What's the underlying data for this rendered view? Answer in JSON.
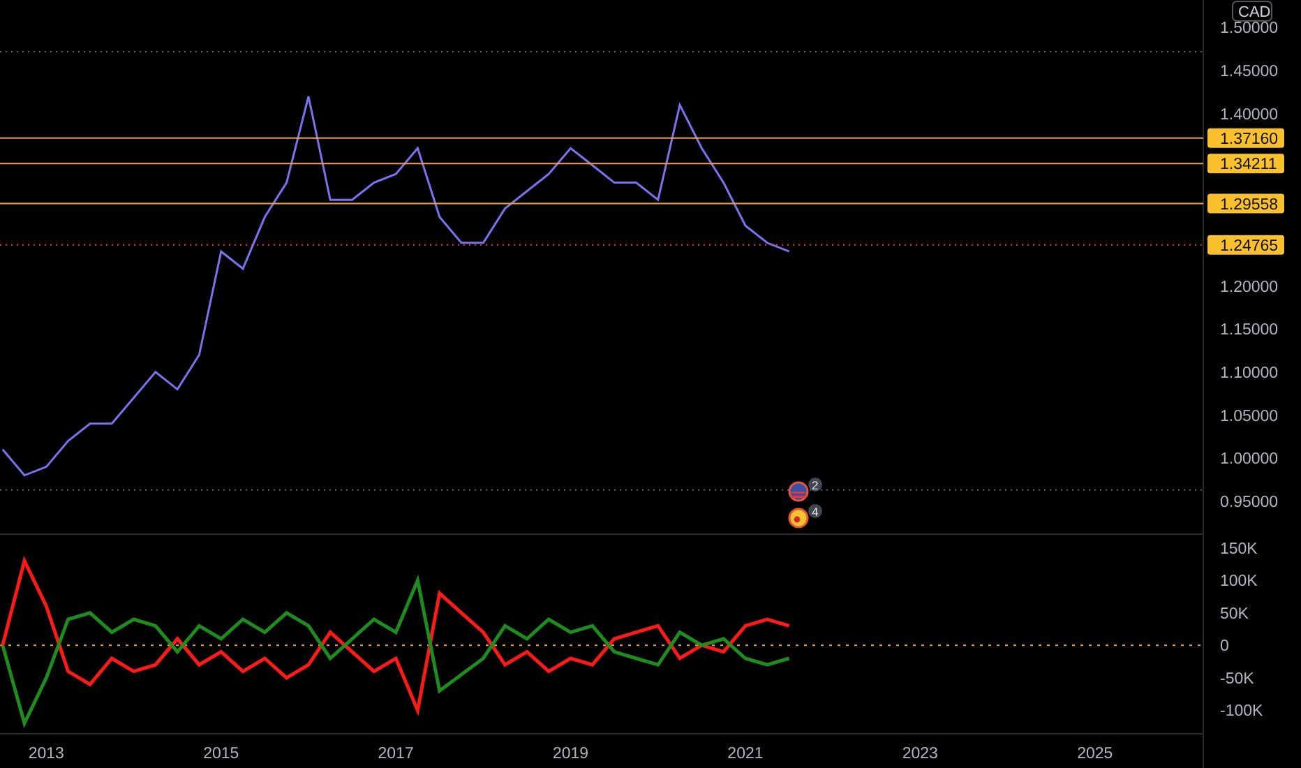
{
  "price_axis": {
    "currency": "CAD"
  },
  "main_chart": {
    "chart_data": {
      "type": "line",
      "series": [
        {
          "color": "#7b72ee",
          "values": [
            1.01,
            0.98,
            0.99,
            1.02,
            1.04,
            1.04,
            1.07,
            1.1,
            1.08,
            1.12,
            1.24,
            1.22,
            1.28,
            1.32,
            1.42,
            1.3,
            1.3,
            1.32,
            1.33,
            1.36,
            1.28,
            1.25,
            1.25,
            1.29,
            1.31,
            1.33,
            1.36,
            1.34,
            1.32,
            1.32,
            1.3,
            1.41,
            1.36,
            1.32,
            1.27,
            1.25,
            1.24
          ]
        }
      ],
      "ylim": [
        0.911,
        1.532
      ],
      "yticks": [
        {
          "value": 0.95,
          "label": "0.95000"
        },
        {
          "value": 1.0,
          "label": "1.00000"
        },
        {
          "value": 1.05,
          "label": "1.05000"
        },
        {
          "value": 1.1,
          "label": "1.10000"
        },
        {
          "value": 1.15,
          "label": "1.15000"
        },
        {
          "value": 1.2,
          "label": "1.20000"
        },
        {
          "value": 1.4,
          "label": "1.40000"
        },
        {
          "value": 1.45,
          "label": "1.45000"
        },
        {
          "value": 1.5,
          "label": "1.50000"
        }
      ],
      "ref_lines": [
        {
          "axis": "y",
          "value": 1.472,
          "color": "#666666"
        },
        {
          "axis": "y",
          "value": 1.3716,
          "label": "1.37160",
          "color": "#f5a623"
        },
        {
          "axis": "y",
          "value": 1.34211,
          "label": "1.34211",
          "color": "#f5a623"
        },
        {
          "axis": "y",
          "value": 1.29558,
          "label": "1.29558",
          "color": "#f5a623"
        },
        {
          "axis": "y",
          "value": 1.24765,
          "label": "1.24765",
          "color": "#e0454b"
        },
        {
          "axis": "y",
          "value": 0.963,
          "color": "#666666"
        }
      ]
    },
    "events": [
      {
        "kind": "striped",
        "count": "2"
      },
      {
        "kind": "emblem",
        "count": "4"
      }
    ]
  },
  "oscillator": {
    "chart_data": {
      "type": "line",
      "x": [
        2012.5,
        2012.75,
        2013,
        2013.25,
        2013.5,
        2013.75,
        2014,
        2014.25,
        2014.5,
        2014.75,
        2015,
        2015.25,
        2015.5,
        2015.75,
        2016,
        2016.25,
        2016.5,
        2016.75,
        2017,
        2017.25,
        2017.5,
        2017.75,
        2018,
        2018.25,
        2018.5,
        2018.75,
        2019,
        2019.25,
        2019.5,
        2019.75,
        2020,
        2020.25,
        2020.5,
        2020.75,
        2021,
        2021.25,
        2021.5
      ],
      "series": [
        {
          "color": "#ff1a1a",
          "values": [
            0,
            130,
            60,
            -40,
            -60,
            -20,
            -40,
            -30,
            10,
            -30,
            -10,
            -40,
            -20,
            -50,
            -30,
            20,
            -10,
            -40,
            -20,
            -100,
            80,
            50,
            20,
            -30,
            -10,
            -40,
            -20,
            -30,
            10,
            20,
            30,
            -20,
            0,
            -10,
            30,
            40,
            30
          ]
        },
        {
          "color": "#1e8c1e",
          "values": [
            0,
            -120,
            -50,
            40,
            50,
            20,
            40,
            30,
            -10,
            30,
            10,
            40,
            20,
            50,
            30,
            -20,
            10,
            40,
            20,
            100,
            -70,
            -45,
            -20,
            30,
            10,
            40,
            20,
            30,
            -10,
            -20,
            -30,
            20,
            0,
            10,
            -20,
            -30,
            -20
          ]
        }
      ],
      "xlim": [
        2012.47,
        2026.24
      ],
      "ylim": [
        -135,
        170
      ],
      "yticks": [
        {
          "value": 150,
          "label": "150K"
        },
        {
          "value": 100,
          "label": "100K"
        },
        {
          "value": 50,
          "label": "50K"
        },
        {
          "value": 0,
          "label": "0"
        },
        {
          "value": -50,
          "label": "-50K"
        },
        {
          "value": -100,
          "label": "-100K"
        }
      ],
      "xticks": [
        {
          "value": 2013,
          "label": "2013"
        },
        {
          "value": 2015,
          "label": "2015"
        },
        {
          "value": 2017,
          "label": "2017"
        },
        {
          "value": 2019,
          "label": "2019"
        },
        {
          "value": 2021,
          "label": "2021"
        },
        {
          "value": 2023,
          "label": "2023"
        },
        {
          "value": 2025,
          "label": "2025"
        }
      ],
      "ref_lines": [
        {
          "axis": "y",
          "value": 0,
          "color": "#f5a623"
        }
      ]
    }
  }
}
